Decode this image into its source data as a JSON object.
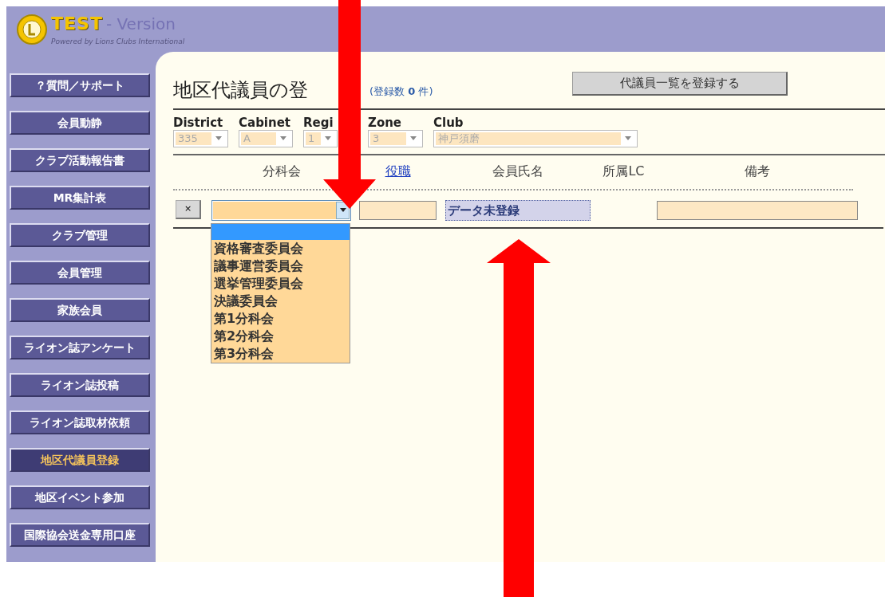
{
  "logo": {
    "brand": "TEST",
    "suffix": "- Version",
    "tagline": "Powered by Lions Clubs International"
  },
  "sidebar": {
    "items": [
      {
        "label": "？質問／サポート",
        "selected": false
      },
      {
        "label": "会員動静",
        "selected": false
      },
      {
        "label": "クラブ活動報告書",
        "selected": false
      },
      {
        "label": "MR集計表",
        "selected": false
      },
      {
        "label": "クラブ管理",
        "selected": false
      },
      {
        "label": "会員管理",
        "selected": false
      },
      {
        "label": "家族会員",
        "selected": false
      },
      {
        "label": "ライオン誌アンケート",
        "selected": false
      },
      {
        "label": "ライオン誌投稿",
        "selected": false
      },
      {
        "label": "ライオン誌取材依頼",
        "selected": false
      },
      {
        "label": "地区代議員登録",
        "selected": true
      },
      {
        "label": "地区イベント参加",
        "selected": false
      },
      {
        "label": "国際協会送金専用口座",
        "selected": false
      }
    ]
  },
  "page": {
    "title": "地区代議員の登",
    "count": "(登録数 **0** 件)",
    "register_button": "代議員一覧を登録する"
  },
  "filters": [
    {
      "label": "District",
      "value": "335"
    },
    {
      "label": "Cabinet",
      "value": "A"
    },
    {
      "label": "Regi",
      "value": "1"
    },
    {
      "label": "Zone",
      "value": "3"
    },
    {
      "label": "Club",
      "value": "神戸須磨"
    }
  ],
  "columns": [
    {
      "label": "分科会",
      "kind": "text"
    },
    {
      "label": "役職",
      "kind": "link"
    },
    {
      "label": "会員氏名",
      "kind": "text"
    },
    {
      "label": "所属LC",
      "kind": "text"
    },
    {
      "label": "備考",
      "kind": "text"
    }
  ],
  "row": {
    "delete_button": "×",
    "status": "データ未登録",
    "dropdown": {
      "expanded": true,
      "options": [
        {
          "selected": true
        },
        {
          "label": "資格審査委員会",
          "selected": false
        },
        {
          "label": "議事運営委員会",
          "selected": false
        },
        {
          "label": "選挙管理委員会",
          "selected": false
        },
        {
          "label": "決議委員会",
          "selected": false
        },
        {
          "label": "第1分科会",
          "selected": false
        },
        {
          "label": "第2分科会",
          "selected": false
        },
        {
          "label": "第3分科会",
          "selected": false
        }
      ]
    }
  },
  "annotations": [
    {
      "kind": "arrow"
    },
    {
      "kind": "arrow"
    }
  ]
}
